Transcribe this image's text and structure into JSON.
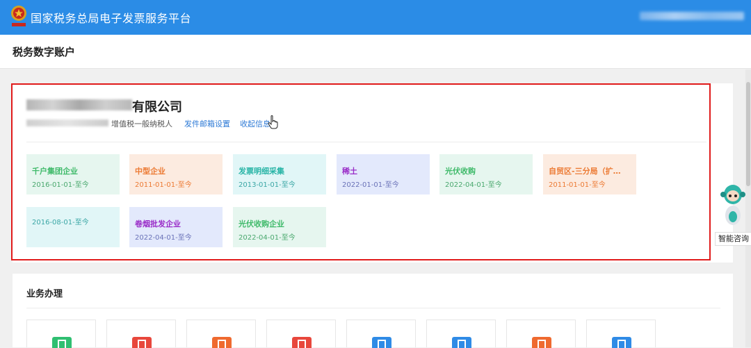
{
  "header": {
    "app_title": "国家税务总局电子发票服务平台",
    "emblem_icon": "national-tax-emblem-icon"
  },
  "page": {
    "title": "税务数字账户"
  },
  "company": {
    "name_suffix": "有限公司",
    "taxpayer_type": "增值税一般纳税人",
    "links": {
      "email_settings": "发件邮箱设置",
      "collapse": "收起信息"
    }
  },
  "tags": [
    {
      "name": "千户集团企业",
      "date": "2016-01-01-至今",
      "color": "green"
    },
    {
      "name": "中型企业",
      "date": "2011-01-01-至今",
      "color": "orange"
    },
    {
      "name": "发票明细采集",
      "date": "2013-01-01-至今",
      "color": "cyan"
    },
    {
      "name": "稀土",
      "date": "2022-01-01-至今",
      "color": "purple"
    },
    {
      "name": "光伏收购",
      "date": "2022-04-01-至今",
      "color": "green"
    },
    {
      "name": "自贸区-三分局（扩…",
      "date": "2011-01-01-至今",
      "color": "orange"
    },
    {
      "name": "",
      "date": "2016-08-01-至今",
      "color": "cyan"
    },
    {
      "name": "卷烟批发企业",
      "date": "2022-04-01-至今",
      "color": "purple"
    },
    {
      "name": "光伏收购企业",
      "date": "2022-04-01-至今",
      "color": "green"
    }
  ],
  "assistant": {
    "label": "智能咨询",
    "icon": "robot-assistant-icon"
  },
  "business": {
    "title": "业务办理",
    "tiles": [
      {
        "icon": "invoice-icon",
        "color": "#2fbf71"
      },
      {
        "icon": "document-icon",
        "color": "#e8473c"
      },
      {
        "icon": "receipt-icon",
        "color": "#ef6a2f"
      },
      {
        "icon": "form-icon",
        "color": "#e8473c"
      },
      {
        "icon": "edit-document-icon",
        "color": "#2f8be6"
      },
      {
        "icon": "mail-icon",
        "color": "#2f8be6"
      },
      {
        "icon": "upload-document-icon",
        "color": "#ef6a2f"
      },
      {
        "icon": "clipboard-icon",
        "color": "#2f8be6"
      }
    ]
  }
}
